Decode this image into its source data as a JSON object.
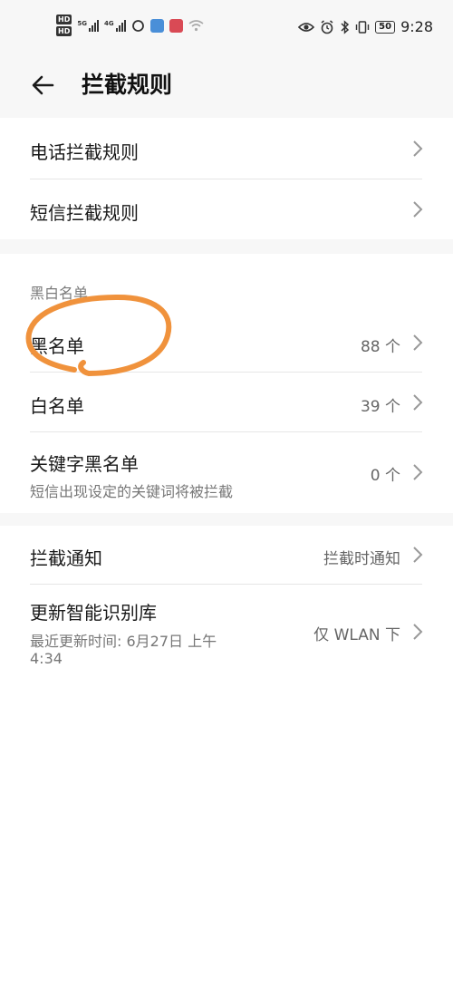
{
  "status_bar": {
    "hd1": "HD",
    "hd2": "HD",
    "net1": "5G",
    "net2": "4G",
    "battery": "50",
    "time": "9:28",
    "icons": [
      "eye-icon",
      "alarm-icon",
      "bluetooth-icon",
      "vibrate-icon"
    ]
  },
  "header": {
    "title": "拦截规则",
    "back_icon": "arrow-left-icon"
  },
  "rules": {
    "call": "电话拦截规则",
    "sms": "短信拦截规则"
  },
  "lists": {
    "section_title": "黑白名单",
    "blacklist": {
      "label": "黑名单",
      "value": "88 个"
    },
    "whitelist": {
      "label": "白名单",
      "value": "39 个"
    },
    "keyword": {
      "label": "关键字黑名单",
      "sub": "短信出现设定的关键词将被拦截",
      "value": "0 个"
    }
  },
  "misc": {
    "notify": {
      "label": "拦截通知",
      "value": "拦截时通知"
    },
    "update": {
      "label": "更新智能识别库",
      "sub1": "最近更新时间: 6月27日 上午",
      "sub2": "4:34",
      "value": "仅 WLAN 下"
    }
  },
  "colors": {
    "annotation": "#f0923c",
    "background": "#f7f7f7",
    "card": "#ffffff"
  }
}
